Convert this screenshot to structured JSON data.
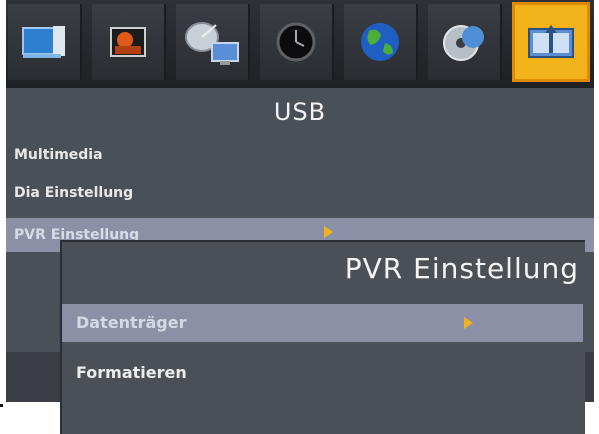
{
  "screen": {
    "icons": [
      {
        "name": "display-icon",
        "selected": false
      },
      {
        "name": "picture-icon",
        "selected": false
      },
      {
        "name": "satellite-dish-icon",
        "selected": false
      },
      {
        "name": "clock-icon",
        "selected": false
      },
      {
        "name": "globe-icon",
        "selected": false
      },
      {
        "name": "disc-icon",
        "selected": false
      },
      {
        "name": "usb-drive-icon",
        "selected": true
      }
    ],
    "section_title": "USB",
    "menu": [
      {
        "label": "Multimedia"
      },
      {
        "label": "Dia Einstellung"
      },
      {
        "label": "PVR Einstellung",
        "highlighted": true
      }
    ]
  },
  "popup": {
    "title": "PVR Einstellung",
    "items": [
      {
        "label": "Datenträger",
        "highlighted": true
      },
      {
        "label": "Formatieren"
      }
    ]
  },
  "colors": {
    "background": "#4a5058",
    "highlight": "#8b90a6",
    "accent": "#f2b21a"
  }
}
